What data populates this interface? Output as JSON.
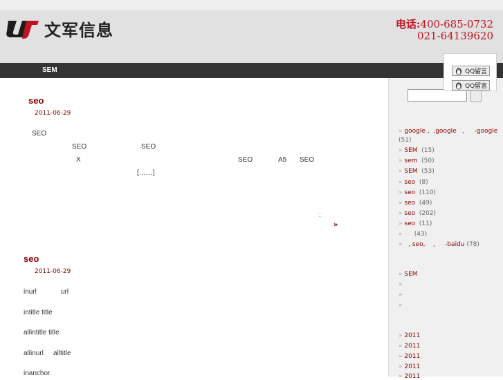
{
  "header": {
    "logo_text": "文军信息",
    "phone_label": "电话:",
    "phone_1": "400-685-0732",
    "phone_2": "021-64139620"
  },
  "nav": {
    "item_1": "SEM"
  },
  "qq": {
    "button_1": "QQ留言",
    "button_2": "QQ留言"
  },
  "posts": [
    {
      "title": "seo",
      "date": "2011-06-29",
      "lines": [
        "SEO",
        "SEO",
        "SEO",
        "X",
        "SEO",
        "A5",
        "SEO",
        "[……]",
        ":"
      ],
      "more": "»"
    },
    {
      "title": "seo",
      "date": "2011-06-29",
      "lines": [
        "inurl",
        "url",
        "intitle title",
        "allintitle title",
        "allinurl",
        "alltitle",
        "inanchor"
      ]
    }
  ],
  "sidebar": {
    "bullet": "»",
    "categories": [
      {
        "a": "google",
        "b": ",",
        "c": ",google",
        "d": ",",
        "e": "-google",
        "count": "(51)"
      },
      {
        "label": "SEM",
        "count": "(15)"
      },
      {
        "label": "sem",
        "count": "(50)"
      },
      {
        "label": "SEM",
        "count": "(53)"
      },
      {
        "label": "seo",
        "count": "(8)"
      },
      {
        "label": "seo",
        "count": "(110)"
      },
      {
        "label": "seo",
        "count": "(49)"
      },
      {
        "label": "seo",
        "count": "(202)"
      },
      {
        "label": "seo",
        "count": "(11)"
      },
      {
        "label": "",
        "count": "(43)"
      },
      {
        "a": ",",
        "b": "seo,",
        "c": ",",
        "d": "-baidu",
        "count": "(78)"
      }
    ],
    "links": [
      "SEM",
      "",
      "",
      ""
    ],
    "archives": [
      "2011",
      "2011",
      "2011",
      "2011",
      "2011"
    ]
  },
  "colors": {
    "accent": "#8b0000",
    "nav_bg": "#333333",
    "header_bg": "#e1e1e1",
    "phone": "#c1121f"
  }
}
